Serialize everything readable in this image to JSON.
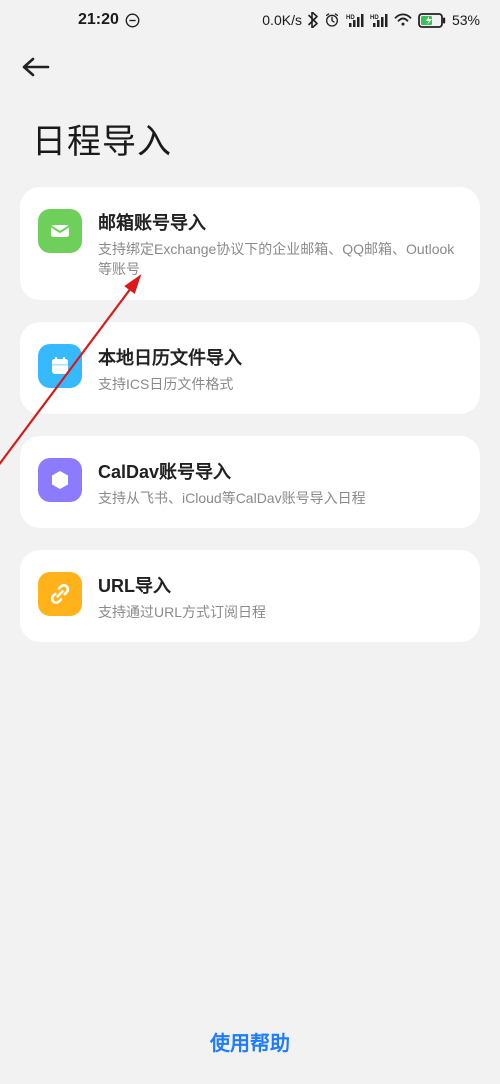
{
  "status_bar": {
    "time": "21:20",
    "net_speed": "0.0K/s",
    "battery_pct": "53%"
  },
  "page": {
    "title": "日程导入"
  },
  "cards": [
    {
      "id": "email",
      "title": "邮箱账号导入",
      "subtitle": "支持绑定Exchange协议下的企业邮箱、QQ邮箱、Outlook等账号",
      "icon_color": "#6fcf5b"
    },
    {
      "id": "local",
      "title": "本地日历文件导入",
      "subtitle": "支持ICS日历文件格式",
      "icon_color": "#37b9ff"
    },
    {
      "id": "caldav",
      "title": "CalDav账号导入",
      "subtitle": "支持从飞书、iCloud等CalDav账号导入日程",
      "icon_color": "#8c7bff"
    },
    {
      "id": "url",
      "title": "URL导入",
      "subtitle": "支持通过URL方式订阅日程",
      "icon_color": "#ffb21a"
    }
  ],
  "help_label": "使用帮助"
}
